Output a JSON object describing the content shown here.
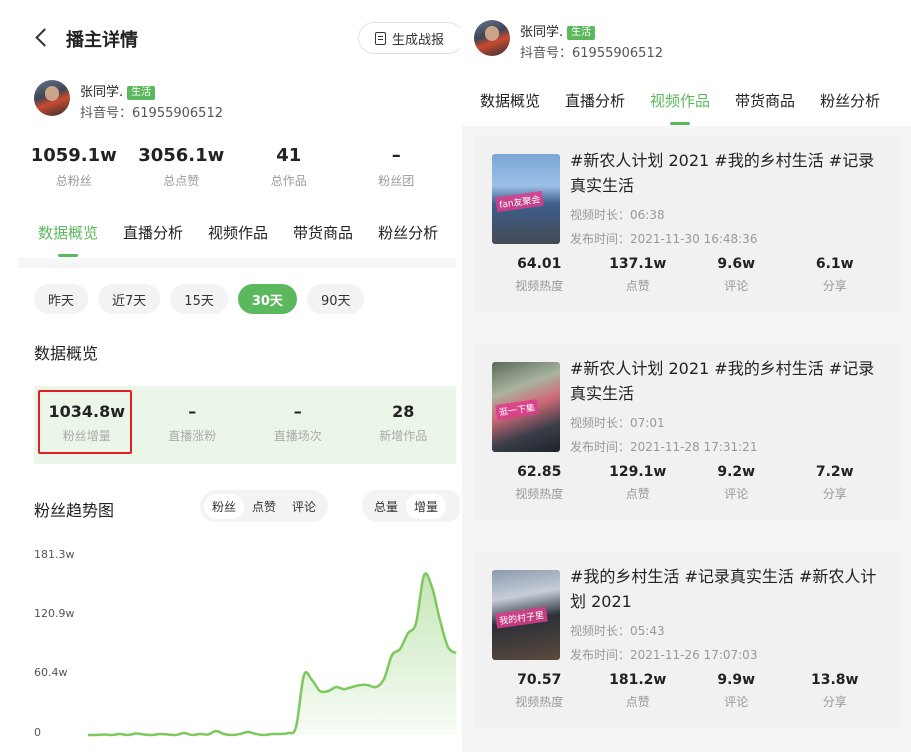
{
  "left": {
    "header": {
      "title": "播主详情",
      "report_button": "生成战报"
    },
    "user": {
      "name": "张同学.",
      "tag": "生活",
      "douyin_id": "抖音号：61955906512"
    },
    "stats": [
      {
        "value": "1059.1w",
        "label": "总粉丝"
      },
      {
        "value": "3056.1w",
        "label": "总点赞"
      },
      {
        "value": "41",
        "label": "总作品"
      },
      {
        "value": "–",
        "label": "粉丝团"
      }
    ],
    "tabs": [
      "数据概览",
      "直播分析",
      "视频作品",
      "带货商品",
      "粉丝分析"
    ],
    "active_tab": 0,
    "periods": [
      "昨天",
      "近7天",
      "15天",
      "30天",
      "90天"
    ],
    "active_period": 3,
    "overview": {
      "title": "数据概览",
      "items": [
        {
          "value": "1034.8w",
          "label": "粉丝增量"
        },
        {
          "value": "–",
          "label": "直播涨粉"
        },
        {
          "value": "–",
          "label": "直播场次"
        },
        {
          "value": "28",
          "label": "新增作品"
        }
      ]
    },
    "trend": {
      "title": "粉丝趋势图",
      "metrics": [
        "粉丝",
        "点赞",
        "评论"
      ],
      "active_metric": 0,
      "modes": [
        "总量",
        "增量"
      ],
      "active_mode": 1
    }
  },
  "chart_data": {
    "type": "area",
    "title": "粉丝趋势图",
    "y_tick_labels": [
      "181.3w",
      "120.9w",
      "60.4w",
      "0"
    ],
    "ylim": [
      0,
      181.3
    ],
    "y_unit": "w",
    "x": [
      1,
      2,
      3,
      4,
      5,
      6,
      7,
      8,
      9,
      10,
      11,
      12,
      13,
      14,
      15,
      16,
      17,
      18,
      19,
      20,
      21,
      22,
      23,
      24,
      25,
      26,
      27,
      28,
      29,
      30,
      31,
      32,
      33,
      34,
      35,
      36,
      37,
      38,
      39,
      40,
      41,
      42,
      43,
      44,
      45,
      46,
      47
    ],
    "values": [
      0,
      0,
      0.5,
      0,
      1,
      0,
      1.5,
      0.5,
      0,
      1,
      0.5,
      0,
      2,
      0,
      1,
      0.5,
      4,
      1,
      0,
      1,
      3,
      1,
      0,
      1,
      1,
      2,
      8,
      60,
      55,
      44,
      44,
      48,
      46,
      48,
      50,
      50,
      48,
      56,
      80,
      86,
      102,
      112,
      160,
      148,
      115,
      88,
      82
    ],
    "color": "#7dc95e",
    "grid": false,
    "legend": "none"
  },
  "right": {
    "user": {
      "name": "张同学.",
      "tag": "生活",
      "douyin_id": "抖音号：61955906512"
    },
    "tabs": [
      "数据概览",
      "直播分析",
      "视频作品",
      "带货商品",
      "粉丝分析"
    ],
    "active_tab": 2,
    "videos": [
      {
        "title": "#新农人计划 2021 #我的乡村生活 #记录真实生活",
        "duration": "视频时长：06:38",
        "published": "发布时间：2021-11-30 16:48:36",
        "thumb_caption": "fan友聚会",
        "stats": [
          {
            "value": "64.01",
            "label": "视频热度"
          },
          {
            "value": "137.1w",
            "label": "点赞"
          },
          {
            "value": "9.6w",
            "label": "评论"
          },
          {
            "value": "6.1w",
            "label": "分享"
          }
        ]
      },
      {
        "title": "#新农人计划 2021 #我的乡村生活 #记录真实生活",
        "duration": "视频时长：07:01",
        "published": "发布时间：2021-11-28 17:31:21",
        "thumb_caption": "逛一下集",
        "stats": [
          {
            "value": "62.85",
            "label": "视频热度"
          },
          {
            "value": "129.1w",
            "label": "点赞"
          },
          {
            "value": "9.2w",
            "label": "评论"
          },
          {
            "value": "7.2w",
            "label": "分享"
          }
        ]
      },
      {
        "title": "#我的乡村生活 #记录真实生活 #新农人计划 2021",
        "duration": "视频时长：05:43",
        "published": "发布时间：2021-11-26 17:07:03",
        "thumb_caption": "我的村子里",
        "stats": [
          {
            "value": "70.57",
            "label": "视频热度"
          },
          {
            "value": "181.2w",
            "label": "点赞"
          },
          {
            "value": "9.9w",
            "label": "评论"
          },
          {
            "value": "13.8w",
            "label": "分享"
          }
        ]
      }
    ]
  },
  "colors": {
    "accent": "#5cb85c",
    "highlight": "#e02020",
    "chart_line": "#7dc95e"
  }
}
